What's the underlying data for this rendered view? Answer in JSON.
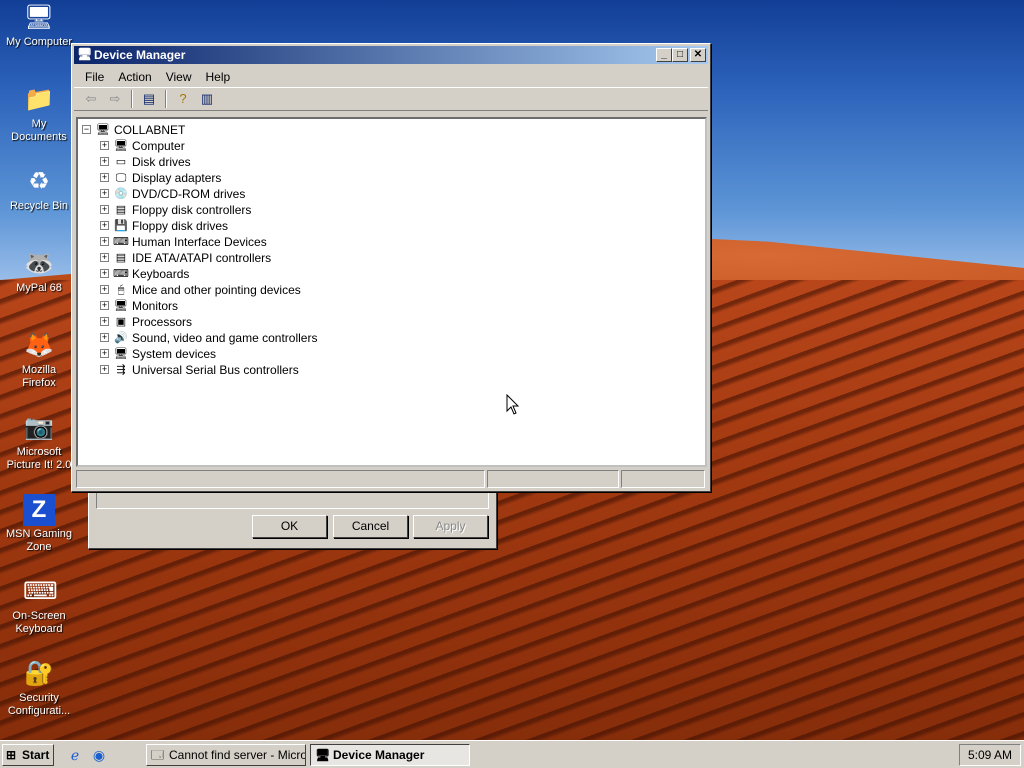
{
  "desktop": {
    "icons": [
      {
        "label": "My Computer",
        "icon": "computer-icon"
      },
      {
        "label": "My Documents",
        "icon": "folder-icon"
      },
      {
        "label": "Recycle Bin",
        "icon": "recycle-bin-icon"
      },
      {
        "label": "MyPal 68",
        "icon": "raccoon-icon"
      },
      {
        "label": "Mozilla Firefox",
        "icon": "firefox-icon"
      },
      {
        "label": "Microsoft Picture It! 2.0",
        "icon": "camera-icon"
      },
      {
        "label": "MSN Gaming Zone",
        "icon": "zone-icon"
      },
      {
        "label": "On-Screen Keyboard",
        "icon": "keyboard-icon"
      },
      {
        "label": "Security Configurati...",
        "icon": "security-icon"
      }
    ]
  },
  "device_manager": {
    "title": "Device Manager",
    "menu": [
      "File",
      "Action",
      "View",
      "Help"
    ],
    "root": "COLLABNET",
    "nodes": [
      {
        "label": "Computer",
        "icon": "computer-node-icon"
      },
      {
        "label": "Disk drives",
        "icon": "disk-drive-icon"
      },
      {
        "label": "Display adapters",
        "icon": "display-adapter-icon"
      },
      {
        "label": "DVD/CD-ROM drives",
        "icon": "cdrom-icon"
      },
      {
        "label": "Floppy disk controllers",
        "icon": "floppy-controller-icon"
      },
      {
        "label": "Floppy disk drives",
        "icon": "floppy-drive-icon"
      },
      {
        "label": "Human Interface Devices",
        "icon": "hid-icon"
      },
      {
        "label": "IDE ATA/ATAPI controllers",
        "icon": "ide-controller-icon"
      },
      {
        "label": "Keyboards",
        "icon": "keyboard-node-icon"
      },
      {
        "label": "Mice and other pointing devices",
        "icon": "mouse-icon"
      },
      {
        "label": "Monitors",
        "icon": "monitor-icon"
      },
      {
        "label": "Processors",
        "icon": "processor-icon"
      },
      {
        "label": "Sound, video and game controllers",
        "icon": "sound-icon"
      },
      {
        "label": "System devices",
        "icon": "system-devices-icon"
      },
      {
        "label": "Universal Serial Bus controllers",
        "icon": "usb-icon"
      }
    ]
  },
  "background_dialog": {
    "ok": "OK",
    "cancel": "Cancel",
    "apply": "Apply"
  },
  "taskbar": {
    "start": "Start",
    "tasks": [
      {
        "label": "Cannot find server - Micro...",
        "active": false
      },
      {
        "label": "Device Manager",
        "active": true
      }
    ],
    "clock": "5:09 AM"
  }
}
